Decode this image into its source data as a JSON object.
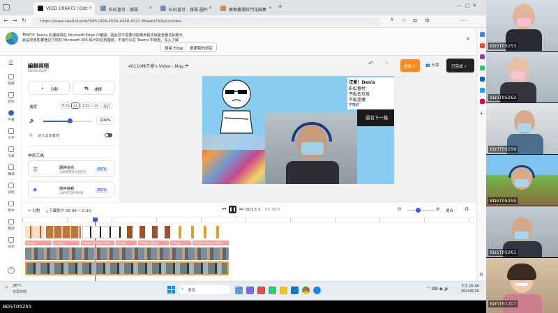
{
  "browser": {
    "tabs": [
      {
        "label": "VEED CR6473 | Edit",
        "active": true
      },
      {
        "label": "紅紅書可 - 搜尋",
        "active": false
      },
      {
        "label": "紅紅書可 - 搜尋 圖片",
        "active": false
      },
      {
        "label": "寮寮農場紅門花園集",
        "active": false
      }
    ],
    "url": "https://www.veed.io/edit/03f51904-4556-4458-8321-96aefe763a1a/video",
    "infobar_line1": "Teams 的連線現在 Microsoft Edge 中離開，因此您不需要切換應用程式就能查看您的聊天",
    "infobar_line2": "此設定會影響登記了您的 Microsoft 365 帳戶的任何連結，不過可以在 Teams 中變更。深入了解",
    "infobar_btn1": "使用 Edge",
    "infobar_btn2": "變更我的設定"
  },
  "rail": [
    "媒體",
    "音訊",
    "字幕",
    "文字",
    "元素",
    "轉場",
    "錄製",
    "範本",
    "翻譯",
    "設定"
  ],
  "panel": {
    "title": "編輯視頻",
    "filename": "Denis.mp4",
    "btn_split": "分割",
    "btn_adjust": "濾鏡",
    "speed_label": "速度",
    "speeds": [
      "0.5x",
      "1x",
      "1.5x",
      "2x",
      "自訂"
    ],
    "volume_value": "100%",
    "fade_label": "淡入淡出音效",
    "ai_tools_title": "神奇工具",
    "tool1_title": "翻譯音訊",
    "tool1_desc": "自動翻譯音訊並配音",
    "tool1_badge": "BETA",
    "tool2_title": "眼神接觸",
    "tool2_desc": "自動修正眼神接觸",
    "tool2_badge": "BETA"
  },
  "editor": {
    "project_title": "40110林方睿's Video - May...",
    "done_btn": "已完成",
    "upgrade_btn": "升級",
    "share_btn": "分享"
  },
  "video": {
    "caption1": "注意！Denis",
    "caption2": "彩虹眷村",
    "caption3": "不亂丟垃圾",
    "caption4": "不亂塗鴉",
    "caption5": "不吸菸",
    "caption6": "還有下一集"
  },
  "controls": {
    "split": "分割",
    "duration": "下載影片 00:09 ~ 0:30",
    "current_time": "00:13.3",
    "total_time": "00:36.8",
    "fit": "適合"
  },
  "timeline": {
    "labels": [
      "Image",
      "Image",
      "Image Image video",
      "Image",
      "Image GIF.gif",
      "Image",
      "Image Image video"
    ]
  },
  "taskbar": {
    "temp": "26°C",
    "weather": "多雲時晴",
    "search": "搜尋",
    "time": "下午 05:00",
    "date": "2024/6/16"
  },
  "participants": [
    {
      "name": "BDST05253"
    },
    {
      "name": "BDST05262"
    },
    {
      "name": "BDST05259"
    },
    {
      "name": "BDST05255"
    },
    {
      "name": "BDST05261"
    },
    {
      "name": "BDST01707"
    }
  ],
  "footer_label": "BDST05255",
  "colors": {
    "accent": "#3b5bdb",
    "upgrade": "#ff8c1a",
    "video_bg": "#87cdf0",
    "timeline_label": "#ff9a94",
    "clip_border": "#f5a623"
  }
}
